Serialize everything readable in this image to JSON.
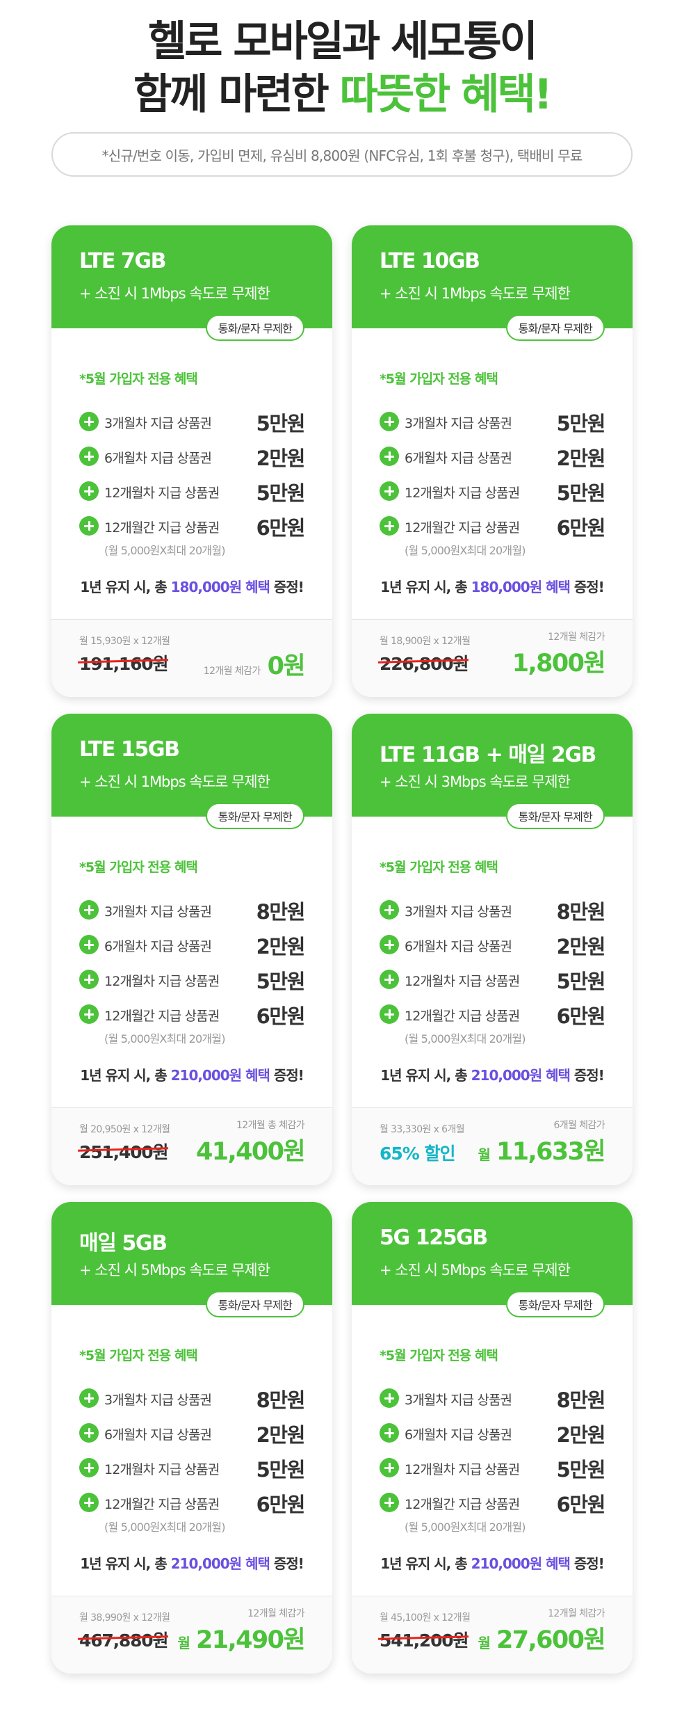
{
  "header": {
    "line1": "헬로 모바일과 세모통이",
    "line2_prefix": "함께 마련한 ",
    "line2_highlight": "따뜻한 혜택!"
  },
  "notice": "*신규/번호 이동, 가입비 면제, 유심비 8,800원 (NFC유심, 1회 후불 청구), 택배비 무료",
  "colors": {
    "brand_green": "#4cc23a",
    "highlight_purple": "#6a4fe0",
    "discount_teal": "#14b6c8",
    "strike_red": "#e8231b"
  },
  "cards": [
    {
      "name": "LTE 7GB",
      "sub": "+ 소진 시 1Mbps 속도로 무제한",
      "badge": "통화/문자 무제한",
      "promo": "*5월 가입자 전용 혜택",
      "benefits": [
        {
          "label": "3개월차 지급 상품권",
          "amount": "5만원"
        },
        {
          "label": "6개월차 지급 상품권",
          "amount": "2만원"
        },
        {
          "label": "12개월차 지급 상품권",
          "amount": "5만원"
        },
        {
          "label": "12개월간 지급 상품권",
          "amount": "6만원",
          "note": "(월 5,000원X최대 20개월)"
        }
      ],
      "total_prefix": "1년 유지 시, 총 ",
      "total_amount": "180,000원 혜택",
      "total_suffix": " 증정!",
      "monthly": "월 15,930원 x 12개월",
      "original": "191,160원",
      "price_label": "12개월 체감가",
      "price": "0원"
    },
    {
      "name": "LTE 10GB",
      "sub": "+ 소진 시 1Mbps 속도로 무제한",
      "badge": "통화/문자 무제한",
      "promo": "*5월 가입자 전용 혜택",
      "benefits": [
        {
          "label": "3개월차 지급 상품권",
          "amount": "5만원"
        },
        {
          "label": "6개월차 지급 상품권",
          "amount": "2만원"
        },
        {
          "label": "12개월차 지급 상품권",
          "amount": "5만원"
        },
        {
          "label": "12개월간 지급 상품권",
          "amount": "6만원",
          "note": "(월 5,000원X최대 20개월)"
        }
      ],
      "total_prefix": "1년 유지 시, 총 ",
      "total_amount": "180,000원 혜택",
      "total_suffix": " 증정!",
      "monthly": "월 18,900원 x 12개월",
      "original": "226,800원",
      "price_label": "12개월 체감가",
      "price": "1,800원"
    },
    {
      "name": "LTE 15GB",
      "sub": "+ 소진 시 1Mbps 속도로 무제한",
      "badge": "통화/문자 무제한",
      "promo": "*5월 가입자 전용 혜택",
      "benefits": [
        {
          "label": "3개월차 지급 상품권",
          "amount": "8만원"
        },
        {
          "label": "6개월차 지급 상품권",
          "amount": "2만원"
        },
        {
          "label": "12개월차 지급 상품권",
          "amount": "5만원"
        },
        {
          "label": "12개월간 지급 상품권",
          "amount": "6만원",
          "note": "(월 5,000원X최대 20개월)"
        }
      ],
      "total_prefix": "1년 유지 시, 총 ",
      "total_amount": "210,000원 혜택",
      "total_suffix": " 증정!",
      "monthly": "월 20,950원 x 12개월",
      "original": "251,400원",
      "price_label": "12개월 총 체감가",
      "price": "41,400원"
    },
    {
      "name": "LTE 11GB + 매일 2GB",
      "sub": "+ 소진 시 3Mbps 속도로 무제한",
      "badge": "통화/문자 무제한",
      "promo": "*5월 가입자 전용 혜택",
      "benefits": [
        {
          "label": "3개월차 지급 상품권",
          "amount": "8만원"
        },
        {
          "label": "6개월차 지급 상품권",
          "amount": "2만원"
        },
        {
          "label": "12개월차 지급 상품권",
          "amount": "5만원"
        },
        {
          "label": "12개월간 지급 상품권",
          "amount": "6만원",
          "note": "(월 5,000원X최대 20개월)"
        }
      ],
      "total_prefix": "1년 유지 시, 총 ",
      "total_amount": "210,000원 혜택",
      "total_suffix": " 증정!",
      "monthly": "월 33,330원 x 6개월",
      "discount": "65% 할인",
      "price_label": "6개월 체감가",
      "price_prefix": "월",
      "price": "11,633원"
    },
    {
      "name": "매일 5GB",
      "sub": "+ 소진 시 5Mbps 속도로 무제한",
      "badge": "통화/문자 무제한",
      "promo": "*5월 가입자 전용 혜택",
      "benefits": [
        {
          "label": "3개월차 지급 상품권",
          "amount": "8만원"
        },
        {
          "label": "6개월차 지급 상품권",
          "amount": "2만원"
        },
        {
          "label": "12개월차 지급 상품권",
          "amount": "5만원"
        },
        {
          "label": "12개월간 지급 상품권",
          "amount": "6만원",
          "note": "(월 5,000원X최대 20개월)"
        }
      ],
      "total_prefix": "1년 유지 시, 총 ",
      "total_amount": "210,000원 혜택",
      "total_suffix": " 증정!",
      "monthly": "월 38,990원 x 12개월",
      "original": "467,880원",
      "price_label": "12개월 체감가",
      "price_prefix": "월",
      "price": "21,490원"
    },
    {
      "name": "5G 125GB",
      "sub": "+ 소진 시 5Mbps 속도로 무제한",
      "badge": "통화/문자 무제한",
      "promo": "*5월 가입자 전용 혜택",
      "benefits": [
        {
          "label": "3개월차 지급 상품권",
          "amount": "8만원"
        },
        {
          "label": "6개월차 지급 상품권",
          "amount": "2만원"
        },
        {
          "label": "12개월차 지급 상품권",
          "amount": "5만원"
        },
        {
          "label": "12개월간 지급 상품권",
          "amount": "6만원",
          "note": "(월 5,000원X최대 20개월)"
        }
      ],
      "total_prefix": "1년 유지 시, 총 ",
      "total_amount": "210,000원 혜택",
      "total_suffix": " 증정!",
      "monthly": "월 45,100원 x 12개월",
      "original": "541,200원",
      "price_label": "12개월 체감가",
      "price_prefix": "월",
      "price": "27,600원"
    }
  ]
}
